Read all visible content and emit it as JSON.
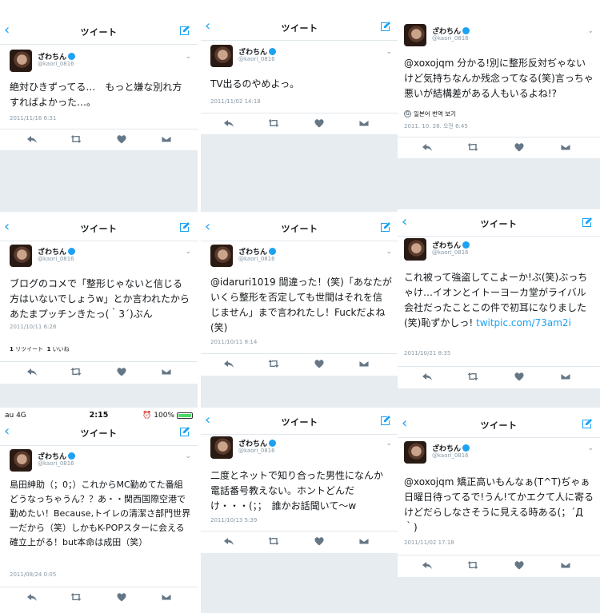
{
  "nav": {
    "title": "ツイート"
  },
  "author": {
    "name": "ざわちん",
    "handle": "@kaori_0816"
  },
  "status_bar": {
    "carrier": "au  4G",
    "time": "2:15",
    "battery": "100%"
  },
  "panels": [
    {
      "text": "絶対ひきずってる…　もっと嫌な別れ方すればよかった…。",
      "timestamp": "2011/11/16 6:31"
    },
    {
      "text": "TV出るのやめよっ。",
      "timestamp": "2011/11/02 14:18"
    },
    {
      "text": "@xoxojqm 分かる!別に整形反対ぢゃないけど気持ちなんか残念ってなる(笑)言っちゃ悪いが結構差がある人もいるよね!?",
      "translate": "일본어 번역 보기",
      "timestamp": "2011. 10. 28. 오전 6:45"
    },
    {
      "text": "ブログのコメで「整形じゃないと信じる方はいないでしょうw」とか言われたからあたまプッチンきたっ(｀3´)ぶん",
      "timestamp": "2011/10/11 6:28",
      "retweets": "1",
      "retweets_label": "リツイート",
      "likes": "1",
      "likes_label": "いいね"
    },
    {
      "text": "@idaruri1019 間違った！(笑)「あなたがいくら整形を否定しても世間はそれを信じません」まで言われたし！Fuckだよね(笑)",
      "timestamp": "2011/10/11 8:14"
    },
    {
      "text": "これ被って強盗してこよーか!ぶ(笑)ぶっちゃけ…イオンとイトーヨーカ堂がライバル会社だったことこの件で初耳になりました(笑)恥ずかしっ! ",
      "link": "twitpic.com/73am2i",
      "timestamp": "2011/10/21 8:35"
    },
    {
      "text": "島田紳助（；0；）これからMC勤めてた番組どうなっちゃうん？？あ・・関西国際空港で勤めたい！Because,トイレの清潔さ部門世界一だから（笑）しかもK-POPスターに会える確立上がる！but本命は成田（笑）",
      "timestamp": "2011/08/24 0:05"
    },
    {
      "text": "二度とネットで知り合った男性になんか電話番号教えない。ホントどんだけ・・・(；；　誰かお話聞いて〜w",
      "timestamp": "2011/10/13 5:39"
    },
    {
      "text": "@xoxojqm 矯正高いもんなぁ(T^T)ぢゃぁ日曜日待ってるで!うん!てかエクて人に寄るけどだらしなさそうに見える時ある(；´Д｀)",
      "timestamp": "2011/11/02 17:18"
    }
  ]
}
